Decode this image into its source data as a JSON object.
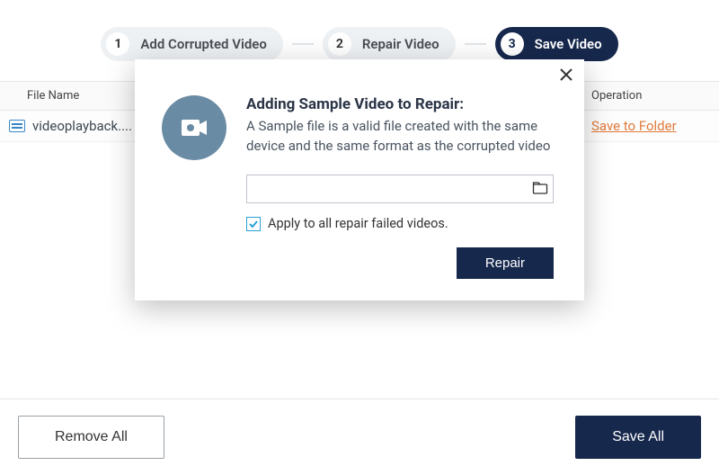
{
  "stepper": {
    "steps": [
      {
        "num": "1",
        "label": "Add Corrupted Video"
      },
      {
        "num": "2",
        "label": "Repair Video"
      },
      {
        "num": "3",
        "label": "Save Video"
      }
    ]
  },
  "grid": {
    "columns": {
      "file": "File Name",
      "operation": "Operation"
    },
    "rows": [
      {
        "file": "videoplayback....",
        "operation": "Save to Folder"
      }
    ]
  },
  "footer": {
    "removeAll": "Remove All",
    "saveAll": "Save All"
  },
  "dialog": {
    "title": "Adding Sample Video to Repair:",
    "desc": "A Sample file is a valid file created with the same device and the same format as the corrupted video",
    "pathValue": "",
    "pathPlaceholder": "",
    "checkboxLabel": "Apply to all repair failed videos.",
    "repair": "Repair"
  }
}
